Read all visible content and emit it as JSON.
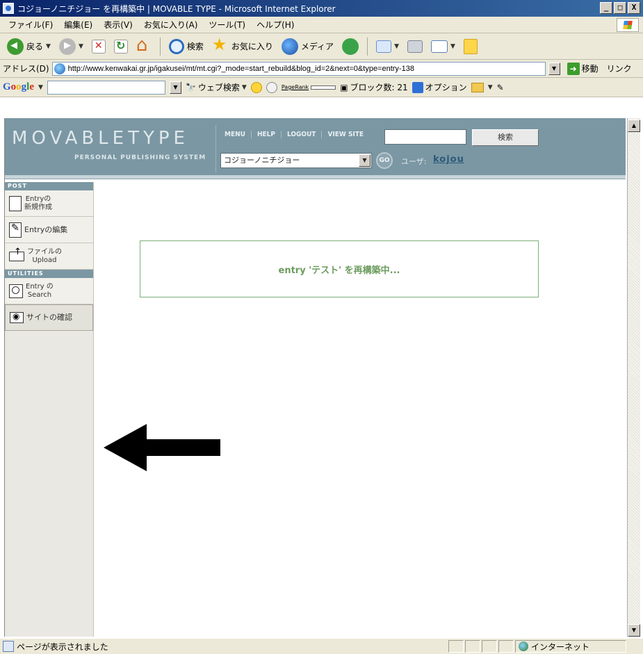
{
  "window": {
    "title": "コジョーノニチジョー を再構築中 | MOVABLE TYPE - Microsoft Internet Explorer",
    "controls": [
      "_",
      "□",
      "X"
    ]
  },
  "menubar": {
    "items": [
      "ファイル(F)",
      "編集(E)",
      "表示(V)",
      "お気に入り(A)",
      "ツール(T)",
      "ヘルプ(H)"
    ]
  },
  "toolbar": {
    "back": "戻る",
    "search": "検索",
    "favorites": "お気に入り",
    "media": "メディア"
  },
  "addressbar": {
    "label": "アドレス(D)",
    "url": "http://www.kenwakai.gr.jp/igakusei/mt/mt.cgi?_mode=start_rebuild&blog_id=2&next=0&type=entry-138",
    "go_label": "移動",
    "links_label": "リンク"
  },
  "googlebar": {
    "logo": "Google",
    "web_search": "ウェブ検索",
    "pagerank": "PageRank",
    "blocked": "ブロック数: 21",
    "options": "オプション"
  },
  "mt": {
    "logo": "MOVABLETYPE",
    "tagline": "PERSONAL PUBLISHING SYSTEM",
    "nav": [
      "MENU",
      "HELP",
      "LOGOUT",
      "VIEW SITE"
    ],
    "search_button": "検索",
    "blog_selected": "コジョーノニチジョー",
    "go": "GO",
    "user_label": "ユーザ:",
    "user_name": "kojou"
  },
  "sidebar": {
    "post_header": "POST",
    "utilities_header": "UTILITIES",
    "items": [
      {
        "line1": "Entryの",
        "line2": "新規作成"
      },
      {
        "line1": "Entryの編集",
        "line2": ""
      },
      {
        "line1": "ファイルの",
        "line2": "Upload"
      },
      {
        "line1": "Entry の",
        "line2": "Search"
      },
      {
        "line1": "サイトの確認",
        "line2": ""
      }
    ]
  },
  "main": {
    "status_message": "entry 'テスト' を再構築中..."
  },
  "statusbar": {
    "text": "ページが表示されました",
    "zone": "インターネット"
  }
}
